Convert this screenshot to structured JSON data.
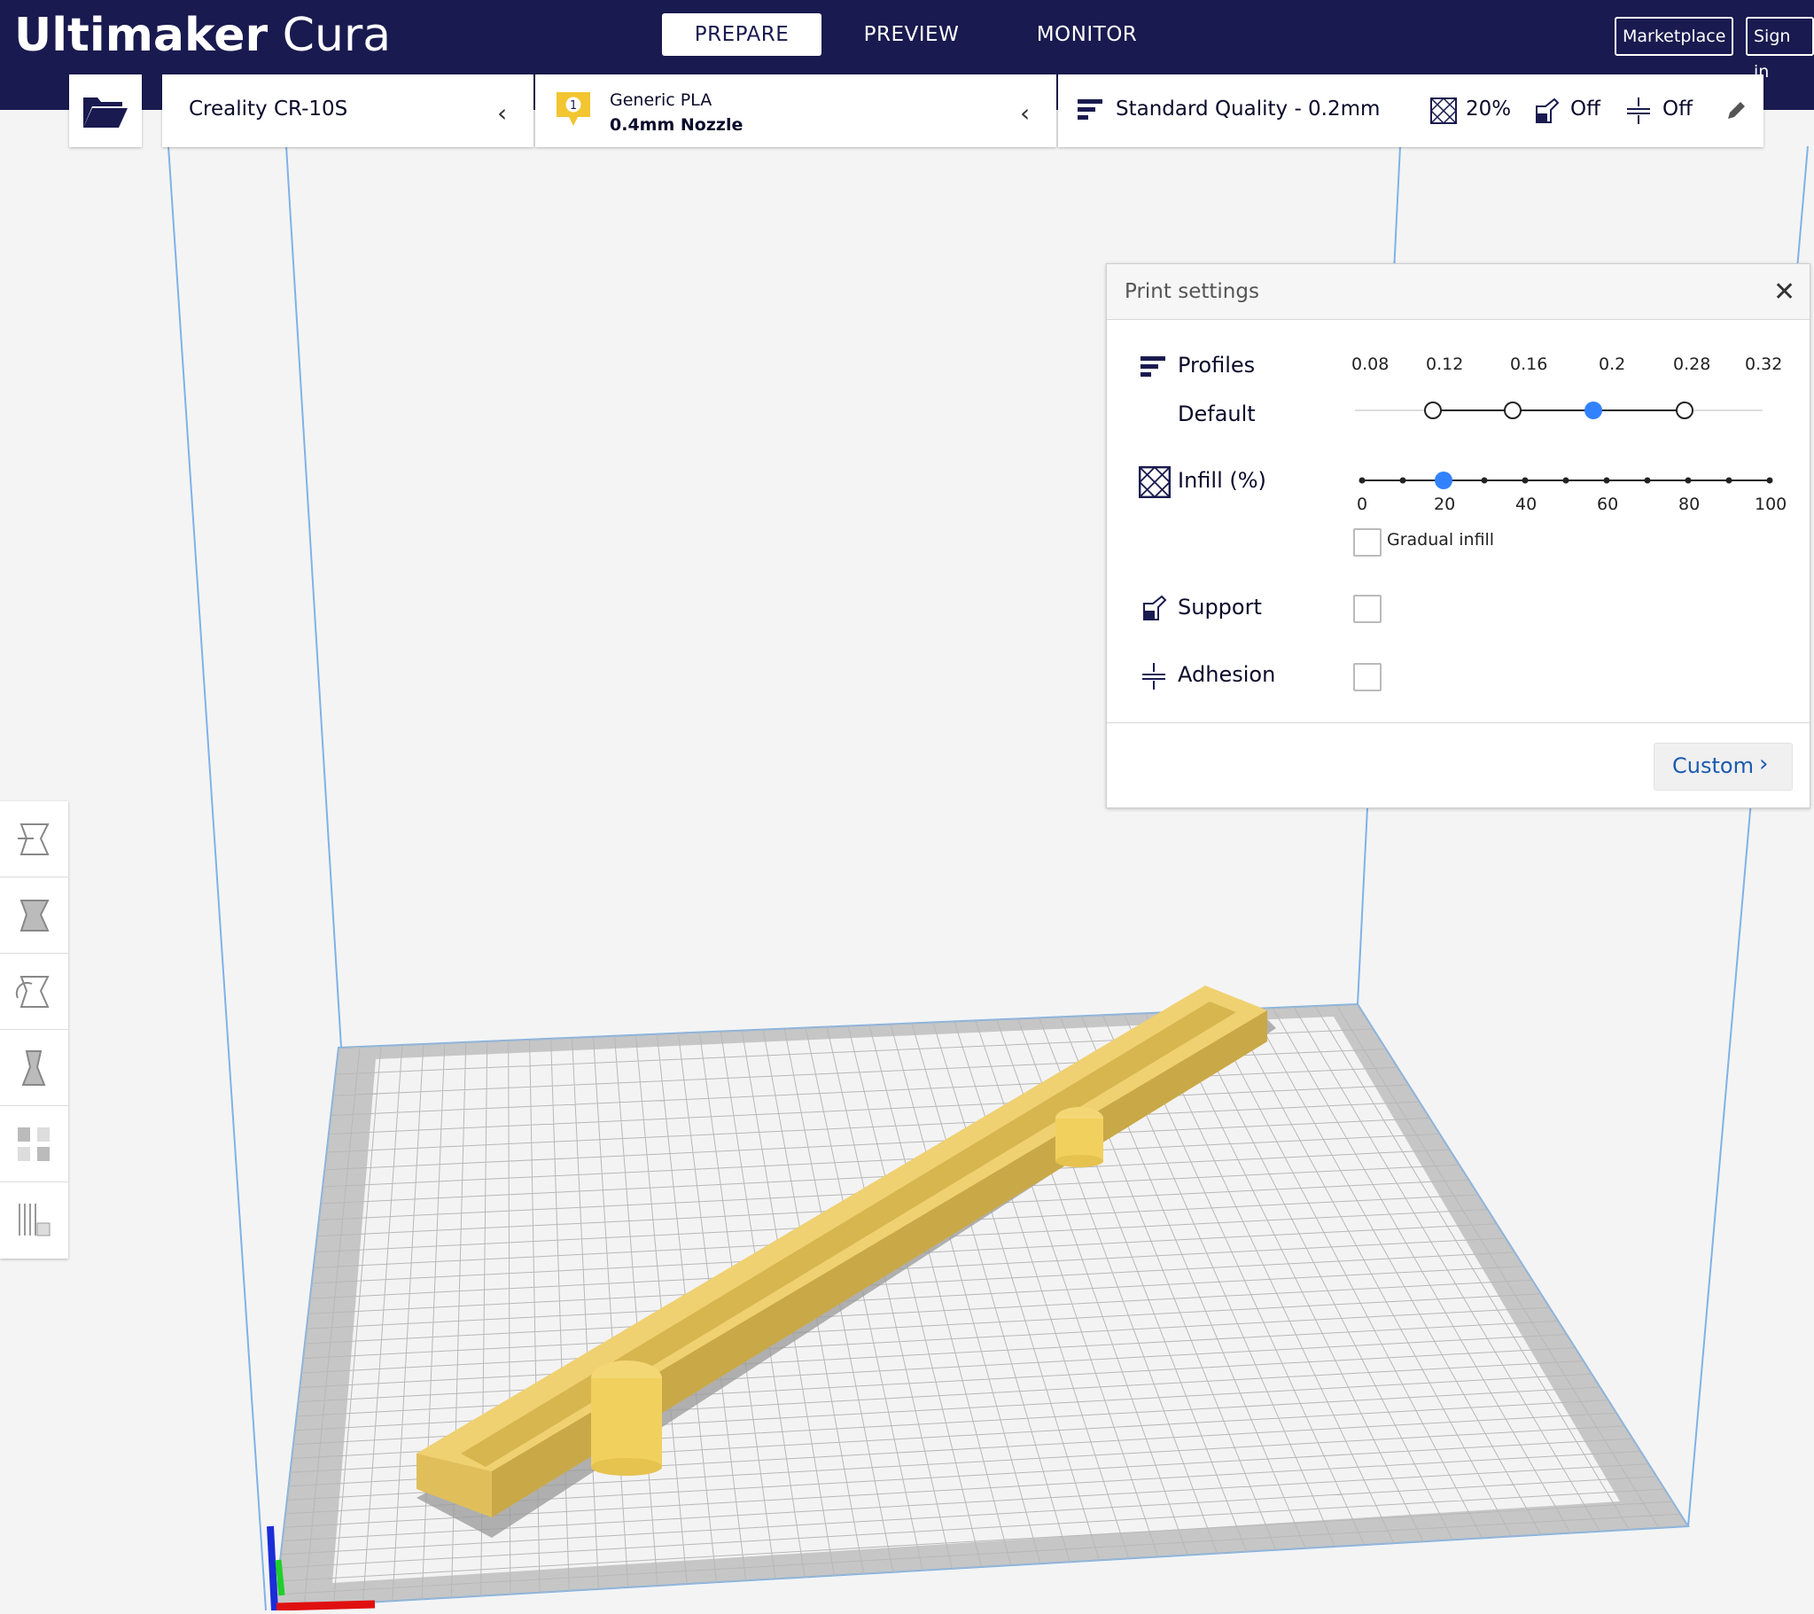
{
  "app": {
    "logo_bold": "Ultimaker",
    "logo_light": "Cura"
  },
  "stages": {
    "prepare": "PREPARE",
    "preview": "PREVIEW",
    "monitor": "MONITOR"
  },
  "header_buttons": {
    "marketplace": "Marketplace",
    "sign_in": "Sign in"
  },
  "printer": {
    "name": "Creality CR-10S"
  },
  "material": {
    "extruder_number": "1",
    "name": "Generic PLA",
    "nozzle": "0.4mm Nozzle"
  },
  "quality_bar": {
    "profile": "Standard Quality - 0.2mm",
    "infill": "20%",
    "support": "Off",
    "adhesion": "Off"
  },
  "print_settings": {
    "title": "Print settings",
    "close_glyph": "✕",
    "profiles_label": "Profiles",
    "profiles_sub": "Default",
    "profile_ticks": [
      "0.08",
      "0.12",
      "0.16",
      "0.2",
      "0.28",
      "0.32"
    ],
    "profile_selected": "0.2",
    "infill_label": "Infill (%)",
    "infill_ticks": [
      "0",
      "20",
      "40",
      "60",
      "80",
      "100"
    ],
    "infill_value": 20,
    "gradual_infill_label": "Gradual infill",
    "gradual_infill_checked": false,
    "support_label": "Support",
    "support_checked": false,
    "adhesion_label": "Adhesion",
    "adhesion_checked": false,
    "custom_button": "Custom",
    "custom_chevron": "›"
  },
  "colors": {
    "header_bg": "#191a4f",
    "accent_blue": "#3282ff",
    "model_yellow": "#e6c65e",
    "build_plate": "#c8c8c8"
  },
  "icons": [
    "folder-open-icon",
    "chevron-left-icon",
    "extruder-badge-icon",
    "profile-icon",
    "infill-icon",
    "support-icon",
    "adhesion-icon",
    "pencil-icon",
    "close-icon",
    "chevron-right-icon",
    "move-tool-icon",
    "scale-tool-icon",
    "rotate-tool-icon",
    "mirror-tool-icon",
    "per-model-settings-icon",
    "support-blocker-icon"
  ]
}
